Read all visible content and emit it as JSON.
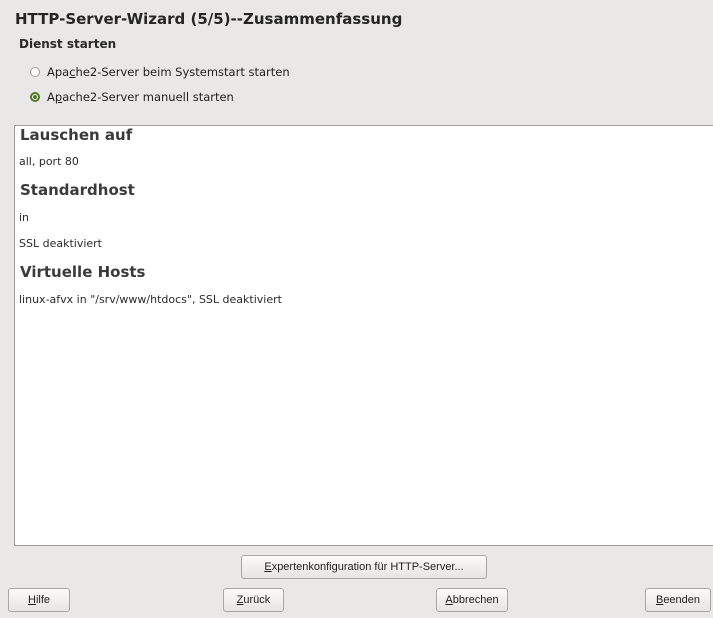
{
  "window": {
    "title": "HTTP-Server-Wizard (5/5)--Zusammenfassung"
  },
  "service": {
    "group_label": "Dienst starten",
    "options": [
      {
        "before": "Apa",
        "mnemonic": "c",
        "after": "he2-Server beim Systemstart starten",
        "selected": false
      },
      {
        "before": "A",
        "mnemonic": "p",
        "after": "ache2-Server manuell starten",
        "selected": true
      }
    ]
  },
  "summary": {
    "listen_heading": "Lauschen auf",
    "listen_value": "all, port 80",
    "default_heading": "Standardhost",
    "default_value": "in",
    "default_ssl": "SSL deaktiviert",
    "vhosts_heading": "Virtuelle Hosts",
    "vhosts_value": "linux-afvx in \"/srv/www/htdocs\", SSL deaktiviert"
  },
  "buttons": {
    "expert": {
      "mnemonic": "E",
      "rest": "xpertenkonfiguration für HTTP-Server..."
    },
    "help": {
      "mnemonic": "H",
      "rest": "ilfe"
    },
    "back": {
      "mnemonic": "Z",
      "rest": "urück"
    },
    "abort": {
      "mnemonic": "A",
      "rest": "bbrechen"
    },
    "finish": {
      "mnemonic": "B",
      "rest": "eenden"
    }
  },
  "colors": {
    "accent": "#4d7a22",
    "background": "#e9e8e6"
  }
}
